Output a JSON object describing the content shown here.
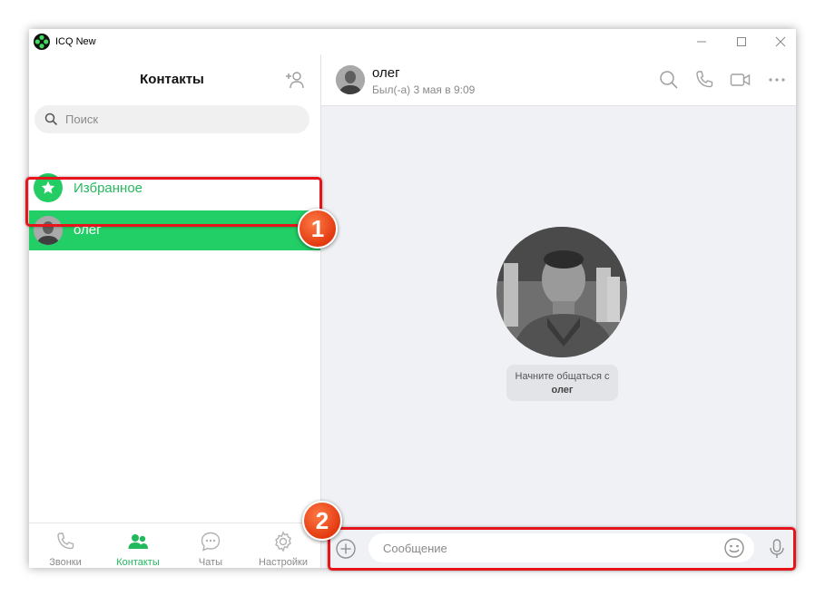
{
  "window": {
    "title": "ICQ New"
  },
  "sidebar": {
    "title": "Контакты",
    "search_placeholder": "Поиск",
    "favorites_label": "Избранное",
    "contacts": [
      {
        "name": "олег"
      }
    ]
  },
  "chat": {
    "contact_name": "олег",
    "status": "Был(-а) 3 мая в 9:09",
    "start_text": "Начните общаться с",
    "start_name": "олег",
    "message_placeholder": "Сообщение"
  },
  "bottom_nav": [
    {
      "label": "Звонки",
      "icon": "phone-icon"
    },
    {
      "label": "Контакты",
      "icon": "contacts-icon",
      "active": true
    },
    {
      "label": "Чаты",
      "icon": "chat-icon"
    },
    {
      "label": "Настройки",
      "icon": "settings-icon"
    }
  ],
  "annotations": {
    "badge1": "1",
    "badge2": "2"
  },
  "colors": {
    "accent": "#22cf67",
    "highlight": "#e8141c",
    "badge": "#e23a10"
  }
}
